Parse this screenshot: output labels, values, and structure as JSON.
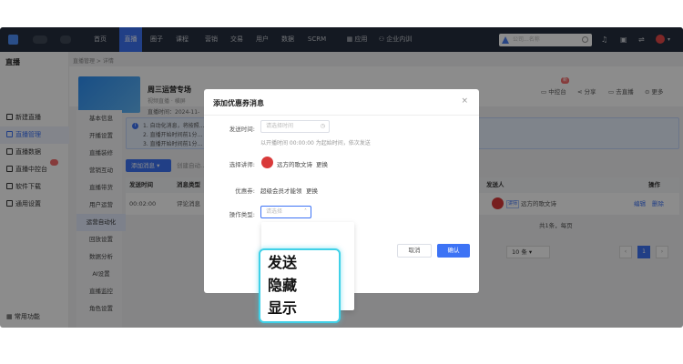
{
  "topnav": {
    "items": [
      "首页",
      "直播",
      "圈子",
      "课程",
      "营销",
      "交易",
      "用户",
      "数据",
      "SCRM",
      "应用",
      "企业内训"
    ],
    "active_index": 1,
    "search_placeholder": "公司...名称"
  },
  "sidebar": {
    "title": "直播",
    "items": [
      "新建直播",
      "直播管理",
      "直播数据",
      "直播中控台",
      "软件下载",
      "通用设置"
    ],
    "active_index": 1,
    "footer": "常用功能"
  },
  "breadcrumb": "直播管理 > 详情",
  "header": {
    "title": "周三运营专场",
    "subtitle": "视频直播 · 横屏",
    "time": "直播时间：2024-11-",
    "actions": [
      "中控台",
      "分享",
      "去直播",
      "更多"
    ],
    "new_badge": "新"
  },
  "subnav": [
    "基本信息",
    "开播设置",
    "直播装修",
    "营销互动",
    "直播带货",
    "用户运营",
    "运营自动化",
    "回放设置",
    "数据分析",
    "AI设置",
    "直播监控",
    "角色设置"
  ],
  "subnav_active_index": 6,
  "info": {
    "lines": [
      "1. 自动化消息，将按照…",
      "2. 直播开始时间前1分…",
      "3. 直播开始时间前1分…"
    ]
  },
  "toolbar": {
    "add_label": "添加消息",
    "secondary_label": "创建自动…"
  },
  "table": {
    "headers": [
      "发送时间",
      "消息类型",
      "发送人",
      "操作"
    ],
    "row": {
      "time": "00:02:00",
      "type": "评论消息",
      "sender": "远方的歌文诗",
      "tag": "讲师",
      "actions": [
        "编辑",
        "删除"
      ]
    }
  },
  "pager": {
    "summary": "共1条，每页",
    "page_size": "10 条",
    "current_page": "1"
  },
  "modal": {
    "title": "添加优惠券消息",
    "send_time_label": "发送时间:",
    "send_time_placeholder": "请选择时间",
    "send_time_help": "以开播时间 00:00:00 为起始时间，依次发送",
    "lecturer_label": "选择讲师:",
    "lecturer_name": "远方的歌文诗",
    "lecturer_change": "更换",
    "coupon_label": "优惠券:",
    "coupon_name": "超级会员才能领",
    "coupon_change": "更换",
    "op_type_label": "操作类型:",
    "op_type_placeholder": "请选择",
    "cancel": "取消",
    "confirm": "确认"
  },
  "dropdown_options": [
    "发送",
    "隐藏",
    "显示"
  ],
  "colors": {
    "accent": "#3d73f5",
    "topbar": "#262f3e",
    "highlight": "#3fd1e8"
  }
}
